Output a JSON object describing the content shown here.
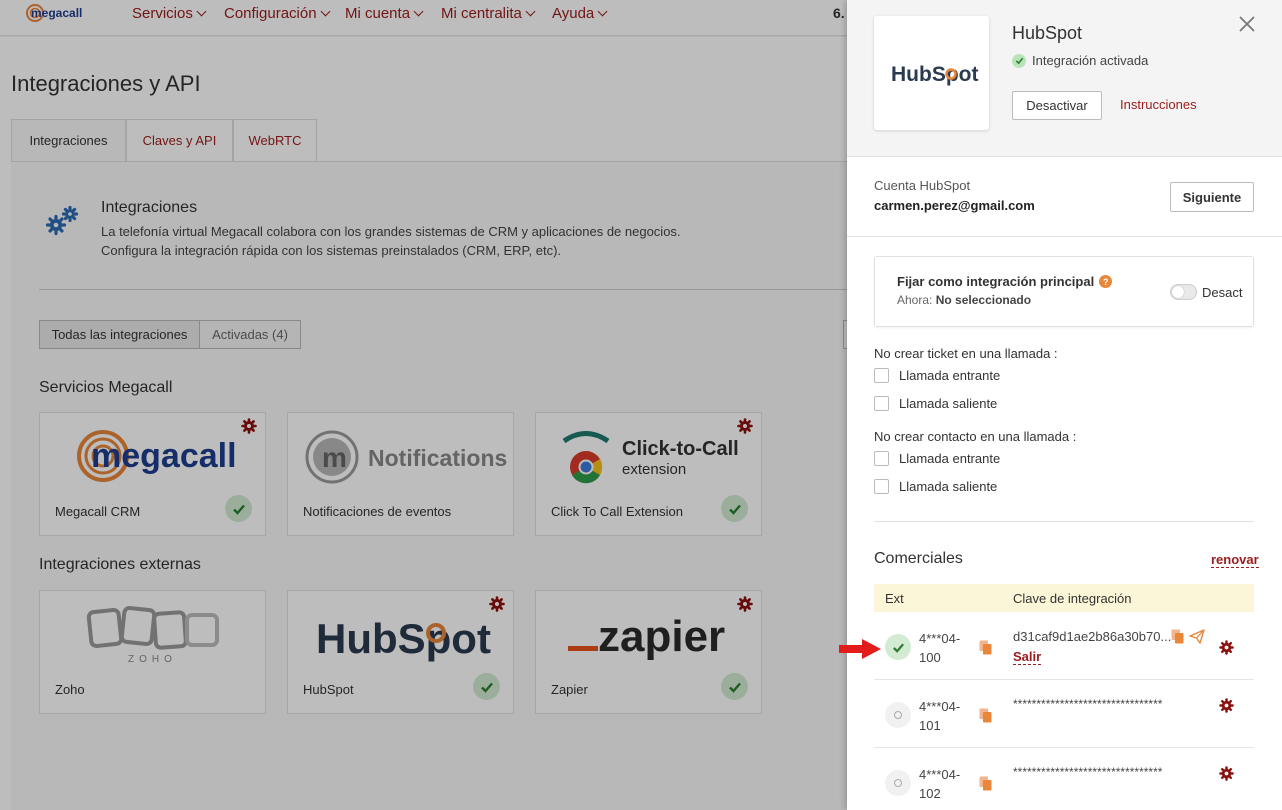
{
  "nav": {
    "logo_text": "megacall",
    "items": [
      {
        "label": "Servicios"
      },
      {
        "label": "Configuración"
      },
      {
        "label": "Mi cuenta"
      },
      {
        "label": "Mi centralita"
      },
      {
        "label": "Ayuda"
      }
    ],
    "balance_fragment": "6."
  },
  "page": {
    "title": "Integraciones y API",
    "tabs": [
      {
        "label": "Integraciones",
        "active": true
      },
      {
        "label": "Claves y API",
        "active": false
      },
      {
        "label": "WebRTC",
        "active": false
      }
    ],
    "intro": {
      "heading": "Integraciones",
      "line1": "La telefonía virtual Megacall colabora con los grandes sistemas de CRM y aplicaciones de negocios.",
      "line2": "Configura la integración rápida con los sistemas preinstalados (CRM, ERP, etc)."
    },
    "filters": [
      {
        "label": "Todas las integraciones",
        "active": true
      },
      {
        "label": "Activadas (4)",
        "active": false
      }
    ],
    "sections": [
      {
        "title": "Servicios Megacall",
        "cards": [
          {
            "label": "Megacall CRM",
            "logo_text": "megacall",
            "active": true,
            "has_gear": true
          },
          {
            "label": "Notificaciones de eventos",
            "logo_text": "Notifications",
            "active": false,
            "has_gear": false
          },
          {
            "label": "Click To Call Extension",
            "logo_text": "Click-to-Call",
            "logo_sub": "extension",
            "active": true,
            "has_gear": true
          }
        ]
      },
      {
        "title": "Integraciones externas",
        "cards": [
          {
            "label": "Zoho",
            "logo_text": "ZOHO",
            "active": false,
            "has_gear": false
          },
          {
            "label": "HubSpot",
            "logo_text": "HubSpot",
            "active": true,
            "has_gear": true
          },
          {
            "label": "Zapier",
            "logo_text": "zapier",
            "active": true,
            "has_gear": true
          }
        ]
      }
    ]
  },
  "panel": {
    "logo_text": "HubSpot",
    "title": "HubSpot",
    "status": "Integración activada",
    "deactivate_label": "Desactivar",
    "instructions_label": "Instrucciones",
    "account": {
      "label": "Cuenta HubSpot",
      "email": "carmen.perez@gmail.com",
      "next_label": "Siguiente"
    },
    "main_integration": {
      "title": "Fijar como integración principal",
      "help": "?",
      "now_label": "Ahora:",
      "now_value": "No seleccionado",
      "toggle_label": "Desact",
      "toggle_on": false
    },
    "no_ticket": {
      "heading": "No crear ticket en una llamada :",
      "options": [
        {
          "label": "Llamada entrante",
          "checked": false
        },
        {
          "label": "Llamada saliente",
          "checked": false
        }
      ]
    },
    "no_contact": {
      "heading": "No crear contacto en una llamada :",
      "options": [
        {
          "label": "Llamada entrante",
          "checked": false
        },
        {
          "label": "Llamada saliente",
          "checked": false
        }
      ]
    },
    "sales": {
      "title": "Comerciales",
      "renew_label": "renovar",
      "col_ext": "Ext",
      "col_key": "Clave de integración",
      "rows": [
        {
          "ext_line1": "4***04-",
          "ext_line2": "100",
          "key": "d31caf9d1ae2b86a30b70...",
          "active": true,
          "logout_label": "Salir"
        },
        {
          "ext_line1": "4***04-",
          "ext_line2": "101",
          "key": "********************************",
          "active": false
        },
        {
          "ext_line1": "4***04-",
          "ext_line2": "102",
          "key": "********************************",
          "active": false
        }
      ]
    }
  },
  "colors": {
    "brand_red": "#9b1c1c",
    "accent_orange": "#e8863a",
    "success_green": "#3c8a3c",
    "arrow_red": "#e21b1b",
    "table_head_bg": "#fbf6d8"
  }
}
